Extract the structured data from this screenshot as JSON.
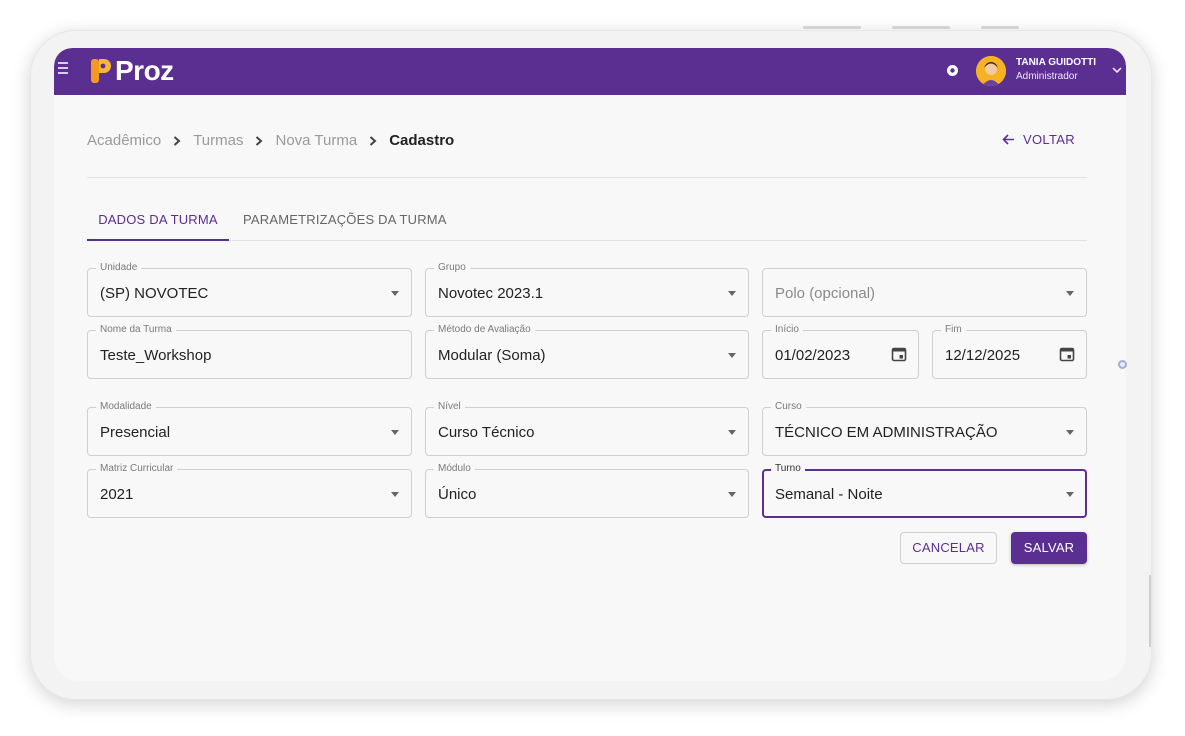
{
  "app": {
    "logo_text": "Proz"
  },
  "colors": {
    "brand": "#5b2e91",
    "logo_orange": "#f39a1f"
  },
  "header": {
    "user_name": "TANIA GUIDOTTI",
    "user_role": "Administrador",
    "icons": [
      "menu-icon",
      "notification-icon",
      "avatar",
      "chevron-down-icon"
    ]
  },
  "breadcrumb": {
    "items": [
      "Acadêmico",
      "Turmas",
      "Nova Turma",
      "Cadastro"
    ]
  },
  "back_label": "VOLTAR",
  "tabs": [
    {
      "label": "DADOS DA TURMA",
      "active": true
    },
    {
      "label": "PARAMETRIZAÇÕES DA TURMA",
      "active": false
    }
  ],
  "form": {
    "unidade": {
      "label": "Unidade",
      "value": "(SP) NOVOTEC"
    },
    "grupo": {
      "label": "Grupo",
      "value": "Novotec 2023.1"
    },
    "polo": {
      "placeholder": "Polo (opcional)"
    },
    "nome_turma": {
      "label": "Nome da Turma",
      "value": "Teste_Workshop"
    },
    "metodo": {
      "label": "Método de Avaliação",
      "value": "Modular (Soma)"
    },
    "inicio": {
      "label": "Início",
      "value": "01/02/2023"
    },
    "fim": {
      "label": "Fim",
      "value": "12/12/2025"
    },
    "modalidade": {
      "label": "Modalidade",
      "value": "Presencial"
    },
    "nivel": {
      "label": "Nível",
      "value": "Curso Técnico"
    },
    "curso": {
      "label": "Curso",
      "value": "TÉCNICO EM ADMINISTRAÇÃO"
    },
    "matriz": {
      "label": "Matriz Curricular",
      "value": "2021"
    },
    "modulo": {
      "label": "Módulo",
      "value": "Único"
    },
    "turno": {
      "label": "Turno",
      "value": "Semanal - Noite"
    }
  },
  "actions": {
    "cancel_label": "CANCELAR",
    "save_label": "SALVAR"
  }
}
